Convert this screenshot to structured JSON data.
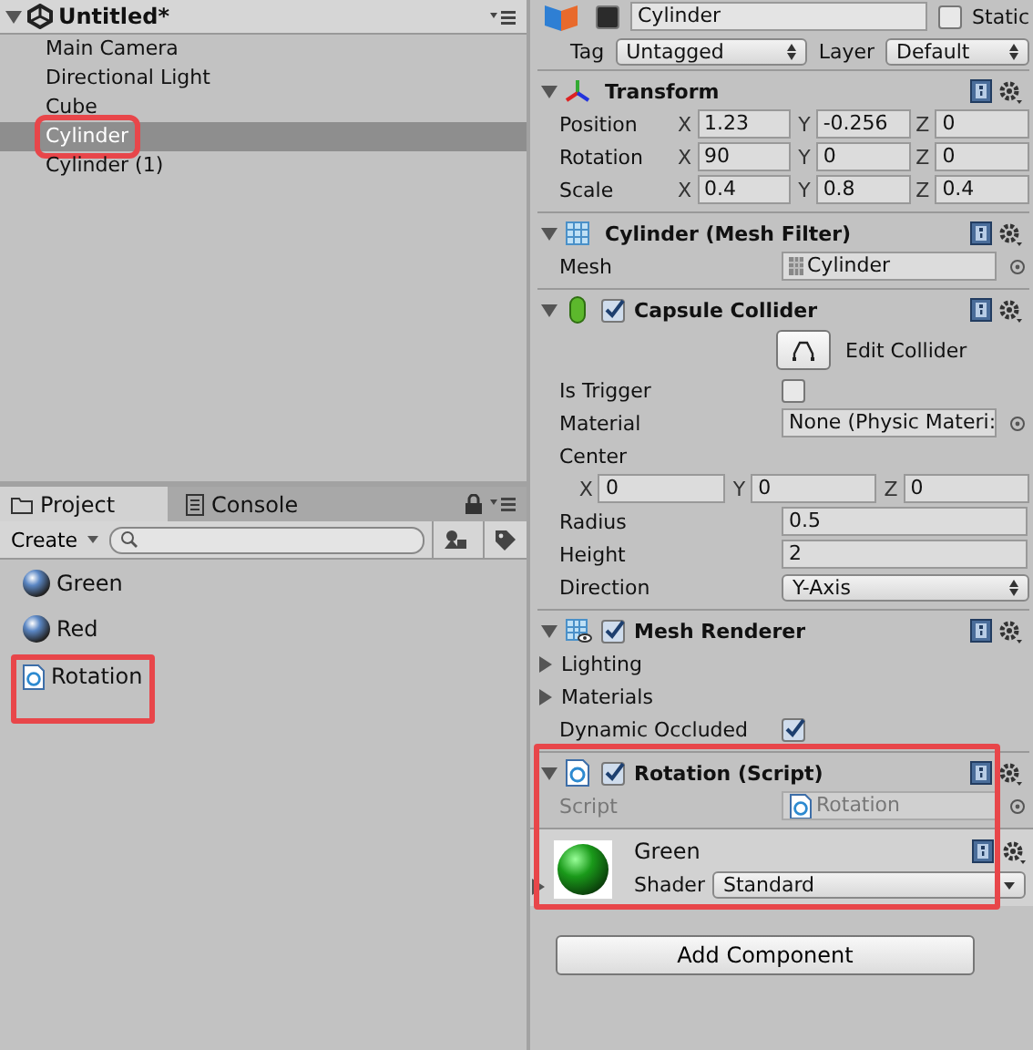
{
  "hierarchy": {
    "title": "Untitled*",
    "items": [
      {
        "label": "Main Camera",
        "selected": false,
        "annotated": false
      },
      {
        "label": "Directional Light",
        "selected": false,
        "annotated": false
      },
      {
        "label": "Cube",
        "selected": false,
        "annotated": false
      },
      {
        "label": "Cylinder",
        "selected": true,
        "annotated": true
      },
      {
        "label": "Cylinder (1)",
        "selected": false,
        "annotated": false
      }
    ]
  },
  "project": {
    "tabs": [
      {
        "label": "Project",
        "selected": true
      },
      {
        "label": "Console",
        "selected": false
      }
    ],
    "create": "Create",
    "assets": [
      {
        "label": "Green",
        "kind": "material",
        "annotated": false
      },
      {
        "label": "Red",
        "kind": "material",
        "annotated": false
      },
      {
        "label": "Rotation",
        "kind": "script",
        "annotated": true
      }
    ]
  },
  "inspector": {
    "header": {
      "active": true,
      "name": "Cylinder",
      "static_label": "Static",
      "static_checked": false,
      "tag_label": "Tag",
      "tag": "Untagged",
      "layer_label": "Layer",
      "layer": "Default"
    },
    "components": [
      {
        "title": "Transform",
        "kind": "transform",
        "annotated": false,
        "rows": [
          {
            "kind": "vector",
            "label": "Position",
            "fields": [
              {
                "axis": "X",
                "value": "1.23"
              },
              {
                "axis": "Y",
                "value": "-0.256"
              },
              {
                "axis": "Z",
                "value": "0"
              }
            ]
          },
          {
            "kind": "vector",
            "label": "Rotation",
            "fields": [
              {
                "axis": "X",
                "value": "90"
              },
              {
                "axis": "Y",
                "value": "0"
              },
              {
                "axis": "Z",
                "value": "0"
              }
            ]
          },
          {
            "kind": "vector",
            "label": "Scale",
            "fields": [
              {
                "axis": "X",
                "value": "0.4"
              },
              {
                "axis": "Y",
                "value": "0.8"
              },
              {
                "axis": "Z",
                "value": "0.4"
              }
            ]
          }
        ]
      },
      {
        "title": "Cylinder (Mesh Filter)",
        "kind": "mesh",
        "annotated": false,
        "rows": [
          {
            "kind": "object",
            "label": "Mesh",
            "value": "Cylinder",
            "disabled": false
          }
        ]
      },
      {
        "title": "Capsule Collider",
        "kind": "capsule",
        "enabled": true,
        "annotated": false,
        "rows": [
          {
            "kind": "button",
            "text": "Edit Collider"
          },
          {
            "kind": "checkbox",
            "label": "Is Trigger",
            "checked": false
          },
          {
            "kind": "reference",
            "label": "Material",
            "value": "None (Physic Materi:",
            "disabled": false
          },
          {
            "kind": "label",
            "label": "Center"
          },
          {
            "kind": "vector",
            "label": "",
            "fields": [
              {
                "axis": "X",
                "value": "0"
              },
              {
                "axis": "Y",
                "value": "0"
              },
              {
                "axis": "Z",
                "value": "0"
              }
            ]
          },
          {
            "kind": "field",
            "label": "Radius",
            "value": "0.5"
          },
          {
            "kind": "field",
            "label": "Height",
            "value": "2"
          },
          {
            "kind": "dropdown",
            "label": "Direction",
            "value": "Y-Axis"
          }
        ]
      },
      {
        "title": "Mesh Renderer",
        "kind": "renderer",
        "enabled": true,
        "annotated": false,
        "rows": [
          {
            "kind": "foldout",
            "label": "Lighting"
          },
          {
            "kind": "foldout",
            "label": "Materials"
          },
          {
            "kind": "checkbox",
            "label": "Dynamic Occluded",
            "checked": true
          }
        ]
      },
      {
        "title": "Rotation (Script)",
        "kind": "script",
        "enabled": true,
        "annotated": true,
        "rows": [
          {
            "kind": "object",
            "label": "Script",
            "value": "Rotation",
            "disabled": true
          }
        ]
      }
    ],
    "material": {
      "name": "Green",
      "shader_label": "Shader",
      "shader": "Standard"
    },
    "add_component": "Add Component"
  }
}
